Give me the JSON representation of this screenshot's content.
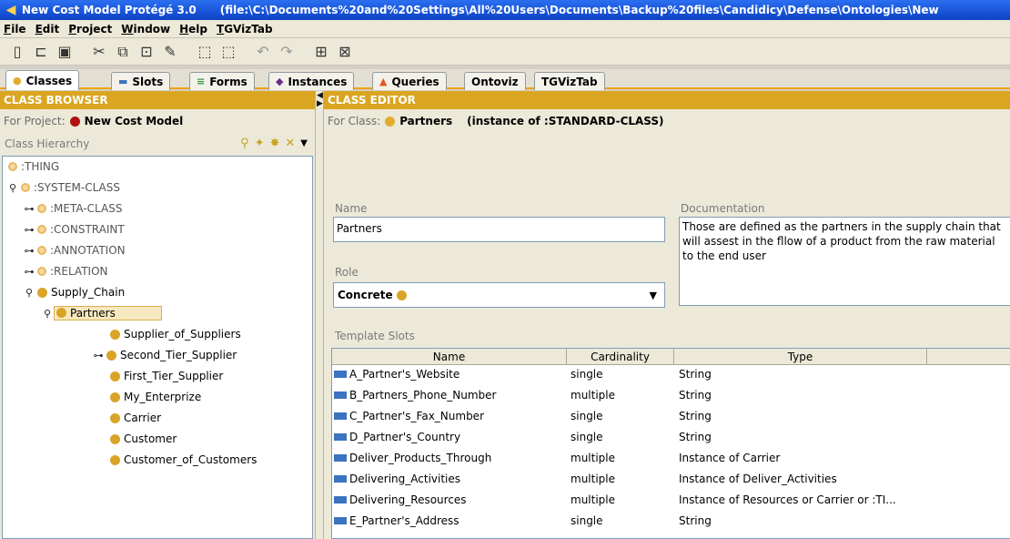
{
  "window": {
    "title_left": "New Cost Model  Protégé 3.0",
    "title_path": "(file:\\C:\\Documents%20and%20Settings\\All%20Users\\Documents\\Backup%20files\\Candidicy\\Defense\\Ontologies\\New"
  },
  "menu": [
    "File",
    "Edit",
    "Project",
    "Window",
    "Help",
    "TGVizTab"
  ],
  "tabs": [
    {
      "label": "Classes",
      "icon": "gold-dot-icon"
    },
    {
      "label": "Slots",
      "icon": "slot-bar-icon"
    },
    {
      "label": "Forms",
      "icon": "form-lines-icon"
    },
    {
      "label": "Instances",
      "icon": "diamond-icon"
    },
    {
      "label": "Queries",
      "icon": "triangle-icon"
    },
    {
      "label": "Ontoviz"
    },
    {
      "label": "TGVizTab"
    }
  ],
  "class_browser": {
    "header": "CLASS BROWSER",
    "for_project_label": "For Project:",
    "project_name": "New Cost Model",
    "hierarchy_label": "Class Hierarchy",
    "tree": [
      {
        "label": ":THING"
      },
      {
        "label": ":SYSTEM-CLASS"
      },
      {
        "label": ":META-CLASS"
      },
      {
        "label": ":CONSTRAINT"
      },
      {
        "label": ":ANNOTATION"
      },
      {
        "label": ":RELATION"
      },
      {
        "label": "Supply_Chain"
      },
      {
        "label": "Partners"
      },
      {
        "label": "Supplier_of_Suppliers"
      },
      {
        "label": "Second_Tier_Supplier"
      },
      {
        "label": "First_Tier_Supplier"
      },
      {
        "label": "My_Enterprize"
      },
      {
        "label": "Carrier"
      },
      {
        "label": "Customer"
      },
      {
        "label": "Customer_of_Customers"
      }
    ]
  },
  "class_editor": {
    "header": "CLASS EDITOR",
    "for_class_label": "For Class:",
    "class_name": "Partners",
    "instance_of": "(instance of :STANDARD-CLASS)",
    "name_label": "Name",
    "name_value": "Partners",
    "documentation_label": "Documentation",
    "documentation_value": "Those are defined as the partners in the supply chain that will assest in the fllow of a product from the raw material to the end user",
    "role_label": "Role",
    "role_value": "Concrete",
    "template_slots_label": "Template Slots",
    "columns": [
      "Name",
      "Cardinality",
      "Type"
    ],
    "slots": [
      [
        "A_Partner's_Website",
        "single",
        "String"
      ],
      [
        "B_Partners_Phone_Number",
        "multiple",
        "String"
      ],
      [
        "C_Partner's_Fax_Number",
        "single",
        "String"
      ],
      [
        "D_Partner's_Country",
        "single",
        "String"
      ],
      [
        "Deliver_Products_Through",
        "multiple",
        "Instance of Carrier"
      ],
      [
        "Delivering_Activities",
        "multiple",
        "Instance of Deliver_Activities"
      ],
      [
        "Delivering_Resources",
        "multiple",
        "Instance of Resources or Carrier or :TI..."
      ],
      [
        "E_Partner's_Address",
        "single",
        "String"
      ]
    ]
  }
}
